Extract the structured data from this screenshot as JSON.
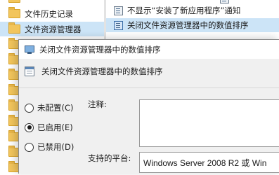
{
  "tree": {
    "items": [
      {
        "label": "文件历史记录",
        "selected": false
      },
      {
        "label": "文件资源管理器",
        "selected": true
      }
    ]
  },
  "policy_list": {
    "items": [
      {
        "label": "不显示“安装了新应用程序”通知",
        "selected": false
      },
      {
        "label": "关闭文件资源管理器中的数值排序",
        "selected": true
      }
    ]
  },
  "dialog": {
    "title": "关闭文件资源管理器中的数值排序",
    "setting_name": "关闭文件资源管理器中的数值排序",
    "state_options": [
      {
        "label": "未配置(C)",
        "checked": false
      },
      {
        "label": "已启用(E)",
        "checked": true
      },
      {
        "label": "已禁用(D)",
        "checked": false
      }
    ],
    "comment_label": "注释:",
    "comment_value": "",
    "supported_label": "支持的平台:",
    "supported_value": "Windows Server 2008 R2 或 Win"
  },
  "colors": {
    "selection": "#cce4f7",
    "dialog_body": "#f0f0f0"
  }
}
